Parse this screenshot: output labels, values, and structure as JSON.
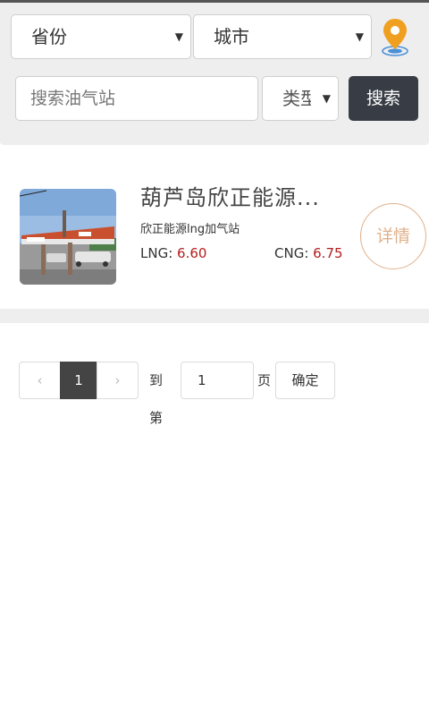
{
  "filters": {
    "province_label": "省份",
    "city_label": "城市",
    "search_placeholder": "搜索油气站",
    "type_label": "类型",
    "search_button": "搜索"
  },
  "station": {
    "name": "葫芦岛欣正能源...",
    "subtitle": "欣正能源lng加气站",
    "lng_label": "LNG: ",
    "lng_price": "6.60",
    "cng_label": "CNG: ",
    "cng_price": "6.75",
    "detail_button": "详情"
  },
  "pagination": {
    "prev": "‹",
    "current": "1",
    "next": "›",
    "goto_prefix": "到第",
    "goto_value": "1",
    "goto_suffix": "页",
    "confirm": "确定"
  },
  "colors": {
    "accent": "#e0b08a",
    "price": "#b41e1e",
    "button_dark": "#383d45",
    "location_pin": "#f0a020"
  },
  "icons": {
    "location": "map-pin-icon",
    "dropdown": "triangle-down-icon"
  }
}
